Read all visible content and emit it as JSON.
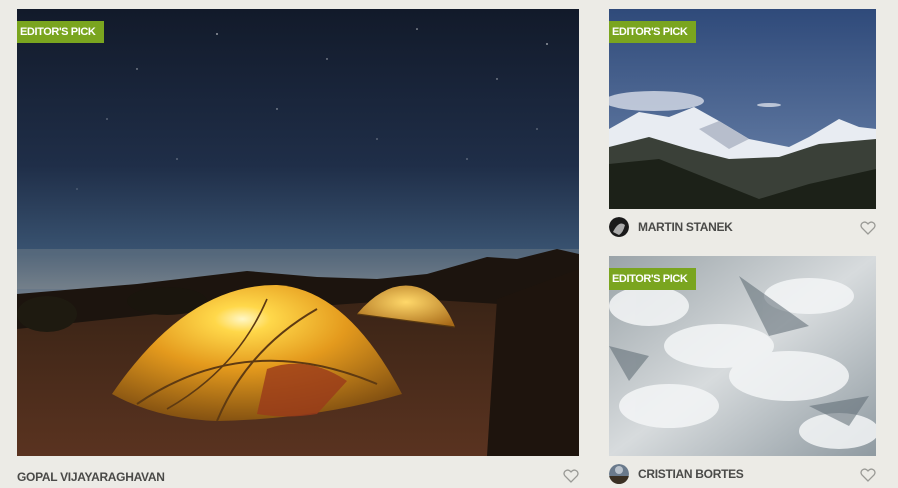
{
  "cards": [
    {
      "badge": "EDITOR'S PICK",
      "photo_subject": "tents under night sky",
      "author": "GOPAL VIJAYARAGHAVAN",
      "icon": "heart-icon"
    },
    {
      "badge": "EDITOR'S PICK",
      "photo_subject": "snowy mountain range",
      "author": "MARTIN STANEK",
      "icon": "heart-icon"
    },
    {
      "badge": "EDITOR'S PICK",
      "photo_subject": "aerial clouds and snow",
      "author": "CRISTIAN BORTES",
      "icon": "heart-icon"
    }
  ],
  "colors": {
    "background": "#ecebe6",
    "badge": "#7aa51f",
    "author_text": "#4a4a48",
    "heart": "#9a9a96"
  }
}
